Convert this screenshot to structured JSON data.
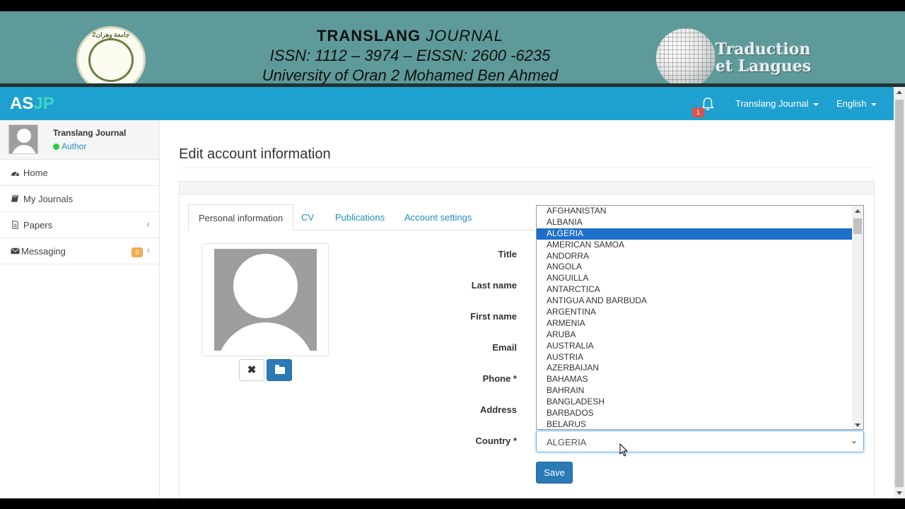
{
  "banner": {
    "seal_text": "جامعة وهران2",
    "line1_bold": "TRANSLANG",
    "line1_rest": " JOURNAL",
    "line2": "ISSN: 1112 – 3974 – EISSN: 2600 -6235",
    "line3": "University of Oran 2 Mohamed Ben Ahmed",
    "logo_line1": "Traduction",
    "logo_line2": "et Langues"
  },
  "nav": {
    "brand_a": "AS",
    "brand_b": "JP",
    "notification_count": "1",
    "journal_menu": "Translang Journal",
    "language_menu": "English"
  },
  "sidebar": {
    "user_name": "Translang Journal",
    "user_role": "Author",
    "items": [
      {
        "label": "Home",
        "icon": "dashboard-icon"
      },
      {
        "label": "My Journals",
        "icon": "book-icon"
      },
      {
        "label": "Papers",
        "icon": "file-icon"
      },
      {
        "label": "Messaging",
        "icon": "envelope-icon",
        "badge": "0"
      }
    ]
  },
  "main": {
    "title": "Edit account information",
    "tabs": [
      "Personal information",
      "CV",
      "Publications",
      "Account settings"
    ],
    "labels": {
      "title": "Title",
      "last_name": "Last name",
      "first_name": "First name",
      "email": "Email",
      "phone": "Phone *",
      "address": "Address",
      "country": "Country *"
    },
    "remove_button": "✖",
    "country_value": "ALGERIA",
    "save_label": "Save"
  },
  "country_options": [
    "AFGHANISTAN",
    "ALBANIA",
    "ALGERIA",
    "AMERICAN SAMOA",
    "ANDORRA",
    "ANGOLA",
    "ANGUILLA",
    "ANTARCTICA",
    "ANTIGUA AND BARBUDA",
    "ARGENTINA",
    "ARMENIA",
    "ARUBA",
    "AUSTRALIA",
    "AUSTRIA",
    "AZERBAIJAN",
    "BAHAMAS",
    "BAHRAIN",
    "BANGLADESH",
    "BARBADOS",
    "BELARUS"
  ],
  "country_selected_index": 2,
  "colors": {
    "nav": "#1ea0d0",
    "banner": "#5f9a9a",
    "primary": "#2a7ab5",
    "link": "#1e8fbf",
    "selected_option": "#1e6fc8"
  }
}
